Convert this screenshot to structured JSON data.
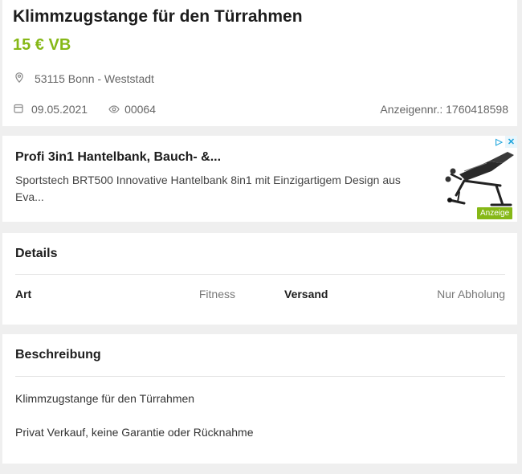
{
  "listing": {
    "title": "Klimmzugstange für den Türrahmen",
    "price": "15 € VB",
    "location": "53115 Bonn - Weststadt",
    "date": "09.05.2021",
    "views": "00064",
    "ad_id": "Anzeigennr.: 1760418598"
  },
  "ad": {
    "title": "Profi 3in1 Hantelbank, Bauch- &...",
    "description": "Sportstech BRT500 Innovative Hantelbank 8in1 mit Einzigartigem Design aus Eva...",
    "badge": "Anzeige",
    "image": "weight-bench-product"
  },
  "details": {
    "heading": "Details",
    "rows": [
      {
        "key": "Art",
        "value": "Fitness"
      },
      {
        "key": "Versand",
        "value": "Nur Abholung"
      }
    ]
  },
  "description": {
    "heading": "Beschreibung",
    "lines": [
      "Klimmzugstange für den Türrahmen",
      "Privat Verkauf, keine Garantie oder Rücknahme"
    ]
  },
  "colors": {
    "price_green": "#86b817",
    "background": "#efefef",
    "adchoices_blue": "#1aa3dc"
  },
  "icons": {
    "location": "map-pin-icon",
    "date": "calendar-icon",
    "views": "eye-icon"
  }
}
